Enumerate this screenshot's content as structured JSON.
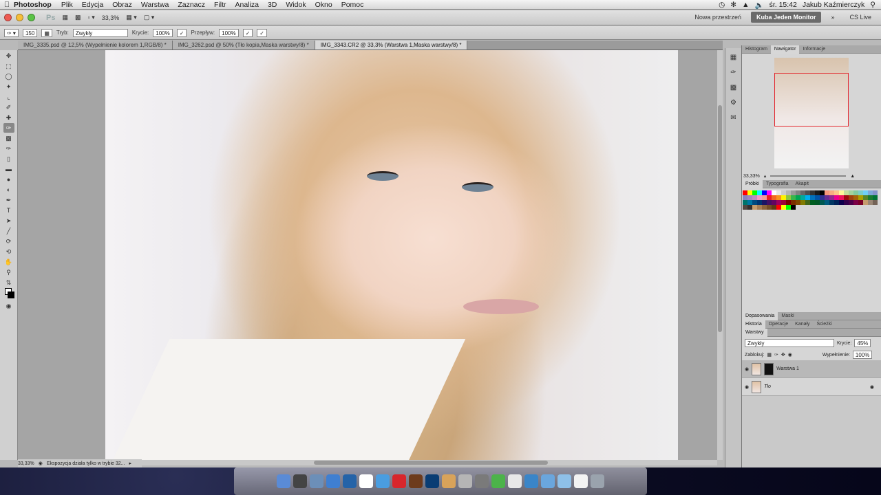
{
  "menubar": {
    "app_name": "Photoshop",
    "items": [
      "Plik",
      "Edycja",
      "Obraz",
      "Warstwa",
      "Zaznacz",
      "Filtr",
      "Analiza",
      "3D",
      "Widok",
      "Okno",
      "Pomoc"
    ],
    "clock": "śr. 15:42",
    "user": "Jakub Kaźmierczyk"
  },
  "appbar": {
    "logo": "Ps",
    "zoom": "33,3%",
    "workspace_new": "Nowa przestrzeń",
    "workspace_active": "Kuba Jeden Monitor",
    "cs_live": "CS Live"
  },
  "options": {
    "brush_size": "150",
    "mode_label": "Tryb:",
    "mode_value": "Zwykły",
    "opacity_label": "Krycie:",
    "opacity_value": "100%",
    "flow_label": "Przepływ:",
    "flow_value": "100%"
  },
  "tabs": [
    {
      "label": "IMG_3335.psd @ 12,5% (Wypełnienie kolorem 1,RGB/8) *"
    },
    {
      "label": "IMG_3262.psd @ 50% (Tło kopia,Maska warstwy/8) *"
    },
    {
      "label": "IMG_3343.CR2 @ 33,3% (Warstwa 1,Maska warstwy/8) *"
    }
  ],
  "status": {
    "zoom": "33,33%",
    "info": "Ekspozycja działa tylko w trybie 32..."
  },
  "navigator": {
    "tabs": [
      "Histogram",
      "Nawigator",
      "Informacje"
    ],
    "zoom": "33,33%"
  },
  "swatches": {
    "tabs": [
      "Próbki",
      "Typografia",
      "Akapit"
    ],
    "colors": [
      "#ff0000",
      "#ffff00",
      "#00ff00",
      "#00ffff",
      "#0000ff",
      "#ff00ff",
      "#ffffff",
      "#e6e6e6",
      "#cccccc",
      "#b3b3b3",
      "#999999",
      "#808080",
      "#666666",
      "#4d4d4d",
      "#333333",
      "#1a1a1a",
      "#000000",
      "#f7977a",
      "#f9ad81",
      "#fdc68a",
      "#fff79a",
      "#c4df9b",
      "#a2d39c",
      "#82ca9d",
      "#7bcdc8",
      "#6ecff6",
      "#7ea7d8",
      "#8493ca",
      "#8882be",
      "#a187be",
      "#bc8dbf",
      "#f49ac2",
      "#f6989d",
      "#ed1c24",
      "#f26522",
      "#f7941d",
      "#fff200",
      "#8dc63f",
      "#39b54a",
      "#00a651",
      "#00a99d",
      "#00aeef",
      "#0072bc",
      "#0054a6",
      "#2e3192",
      "#662d91",
      "#92278f",
      "#ec008c",
      "#ed145b",
      "#9e0b0f",
      "#a0410d",
      "#a36209",
      "#aba000",
      "#598527",
      "#1a7b30",
      "#007236",
      "#00746b",
      "#0076a3",
      "#004a80",
      "#003471",
      "#1b1464",
      "#440e62",
      "#630460",
      "#9e005d",
      "#9e0039",
      "#790000",
      "#7b2e00",
      "#7d4900",
      "#827b00",
      "#406618",
      "#005e20",
      "#005826",
      "#005952",
      "#005b7f",
      "#003663",
      "#002157",
      "#0d004c",
      "#32004b",
      "#4b0049",
      "#7b0046",
      "#7a0026",
      "#c69c6d",
      "#998675",
      "#736357",
      "#534741",
      "#37302d",
      "#c69c6d",
      "#a67c52",
      "#8c6239",
      "#754c24",
      "#603913",
      "#ff0000",
      "#ffff00",
      "#00ff00",
      "#000000"
    ]
  },
  "adjust_tabs": [
    "Dopasowania",
    "Maski"
  ],
  "history_tabs": [
    "Historia",
    "Operacje",
    "Kanały",
    "Ścieżki"
  ],
  "layers": {
    "tab": "Warstwy",
    "blend": "Zwykły",
    "opacity_label": "Krycie:",
    "opacity_value": "45%",
    "lock_label": "Zablokuj:",
    "fill_label": "Wypełnienie:",
    "fill_value": "100%",
    "items": [
      {
        "name": "Warstwa 1"
      },
      {
        "name": "Tło"
      }
    ]
  }
}
